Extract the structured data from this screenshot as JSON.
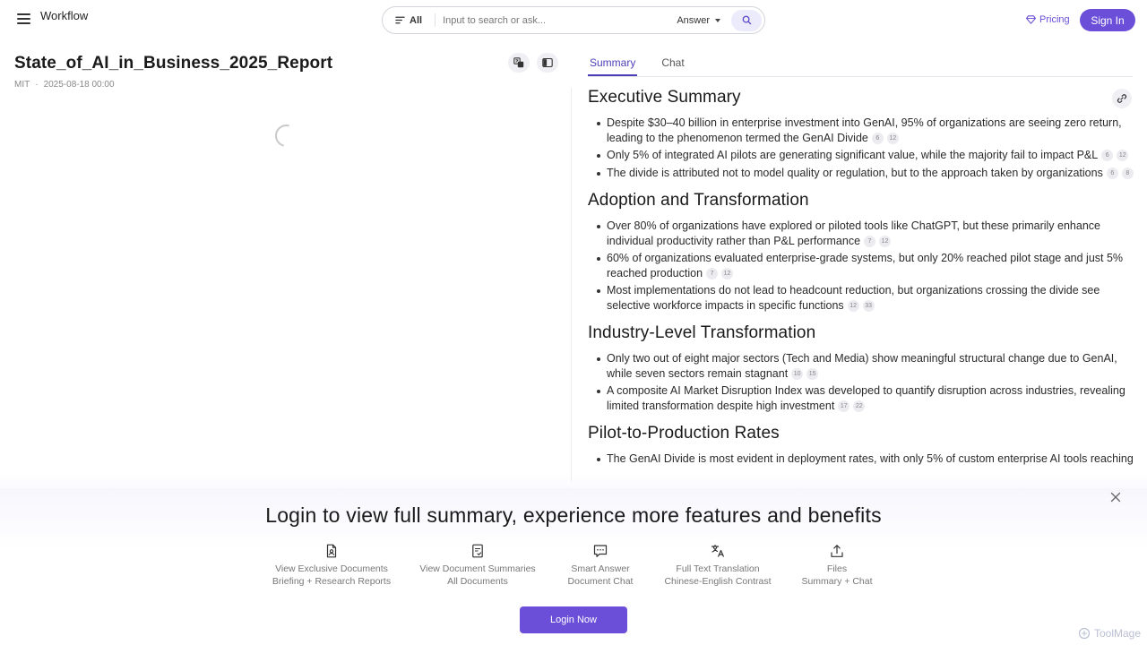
{
  "header": {
    "logo_alt": "Workflow",
    "search": {
      "scope_label": "All",
      "placeholder": "Input to search or ask...",
      "mode_label": "Answer"
    },
    "pricing_label": "Pricing",
    "signin_label": "Sign In"
  },
  "document": {
    "title": "State_of_AI_in_Business_2025_Report",
    "source": "MIT",
    "separator": "·",
    "date": "2025-08-18 00:00"
  },
  "tabs": [
    {
      "label": "Summary",
      "active": true
    },
    {
      "label": "Chat",
      "active": false
    }
  ],
  "summary": {
    "sections": [
      {
        "title": "Executive Summary",
        "items": [
          {
            "text": "Despite $30–40 billion in enterprise investment into GenAI, 95% of organizations are seeing zero return, leading to the phenomenon termed the GenAI Divide",
            "cites": [
              "6",
              "12"
            ]
          },
          {
            "text": "Only 5% of integrated AI pilots are generating significant value, while the majority fail to impact P&L",
            "cites": [
              "6",
              "12"
            ]
          },
          {
            "text": "The divide is attributed not to model quality or regulation, but to the approach taken by organizations",
            "cites": [
              "6",
              "8"
            ]
          }
        ]
      },
      {
        "title": "Adoption and Transformation",
        "items": [
          {
            "text": "Over 80% of organizations have explored or piloted tools like ChatGPT, but these primarily enhance individual productivity rather than P&L performance",
            "cites": [
              "7",
              "12"
            ]
          },
          {
            "text": "60% of organizations evaluated enterprise-grade systems, but only 20% reached pilot stage and just 5% reached production",
            "cites": [
              "7",
              "12"
            ]
          },
          {
            "text": "Most implementations do not lead to headcount reduction, but organizations crossing the divide see selective workforce impacts in specific functions",
            "cites": [
              "12",
              "33"
            ]
          }
        ]
      },
      {
        "title": "Industry-Level Transformation",
        "items": [
          {
            "text": "Only two out of eight major sectors (Tech and Media) show meaningful structural change due to GenAI, while seven sectors remain stagnant",
            "cites": [
              "10",
              "15"
            ]
          },
          {
            "text": "A composite AI Market Disruption Index was developed to quantify disruption across industries, revealing limited transformation despite high investment",
            "cites": [
              "17",
              "22"
            ]
          }
        ]
      },
      {
        "title": "Pilot-to-Production Rates",
        "items": [
          {
            "text": "The GenAI Divide is most evident in deployment rates, with only 5% of custom enterprise AI tools reaching",
            "cites": []
          }
        ]
      }
    ]
  },
  "promo": {
    "title": "Login to view full summary, experience more features and benefits",
    "features": [
      {
        "icon": "document-icon",
        "line1": "View Exclusive Documents",
        "line2": "Briefing + Research Reports"
      },
      {
        "icon": "checklist-icon",
        "line1": "View Document Summaries",
        "line2": "All Documents"
      },
      {
        "icon": "chat-icon",
        "line1": "Smart Answer",
        "line2": "Document Chat"
      },
      {
        "icon": "translate-icon",
        "line1": "Full Text Translation",
        "line2": "Chinese-English Contrast"
      },
      {
        "icon": "upload-icon",
        "line1": "Files",
        "line2": "Summary + Chat"
      }
    ],
    "login_label": "Login Now"
  },
  "watermark": "ToolMage",
  "colors": {
    "accent": "#6b4fd8",
    "tab_active": "#4d3fb8"
  }
}
